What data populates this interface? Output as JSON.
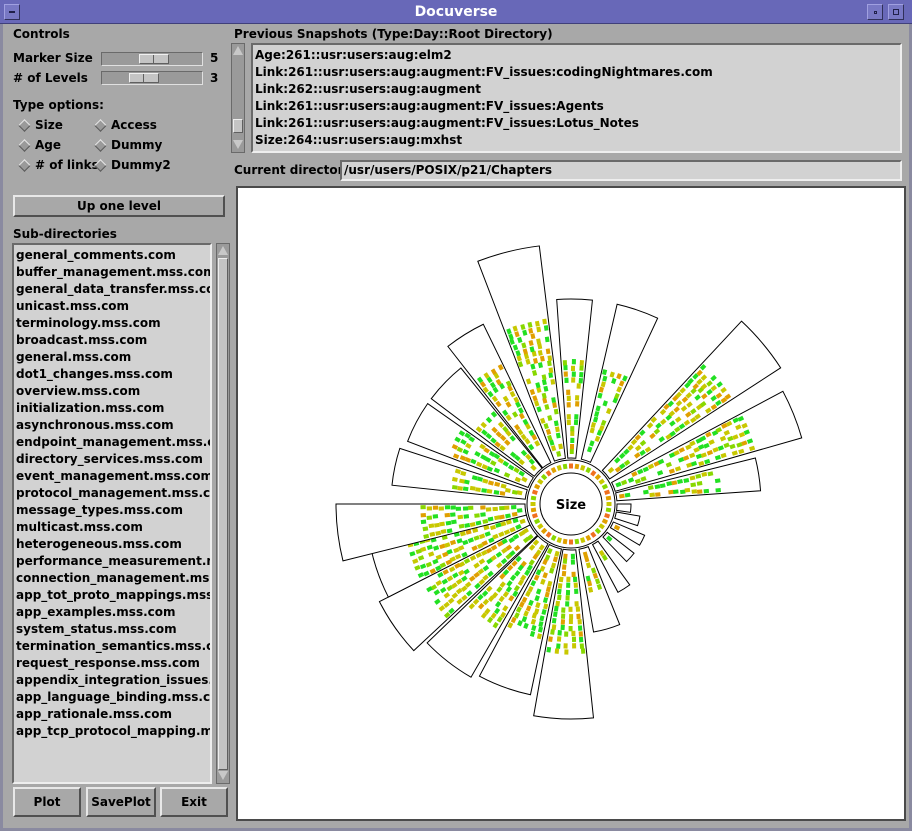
{
  "window": {
    "title": "Docuverse"
  },
  "controls": {
    "heading": "Controls",
    "marker_size_label": "Marker Size",
    "marker_size_value": "5",
    "marker_size_fraction": 0.55,
    "levels_label": "# of Levels",
    "levels_value": "3",
    "levels_fraction": 0.4,
    "type_options_label": "Type options:",
    "type_options": [
      "Size",
      "Access",
      "Age",
      "Dummy",
      "# of links",
      "Dummy2"
    ],
    "up_button": "Up one level"
  },
  "subdirs": {
    "heading": "Sub-directories",
    "items": [
      "general_comments.com",
      "buffer_management.mss.com",
      "general_data_transfer.mss.com",
      "unicast.mss.com",
      "terminology.mss.com",
      "broadcast.mss.com",
      "general.mss.com",
      "dot1_changes.mss.com",
      "overview.mss.com",
      "initialization.mss.com",
      "asynchronous.mss.com",
      "endpoint_management.mss.com",
      "directory_services.mss.com",
      "event_management.mss.com",
      "protocol_management.mss.com",
      "message_types.mss.com",
      "multicast.mss.com",
      "heterogeneous.mss.com",
      "performance_measurement.mss",
      "connection_management.mss.co",
      "app_tot_proto_mappings.mss.co",
      "app_examples.mss.com",
      "system_status.mss.com",
      "termination_semantics.mss.com",
      "request_response.mss.com",
      "appendix_integration_issues.ms:",
      "app_language_binding.mss.com",
      "app_rationale.mss.com",
      "app_tcp_protocol_mapping.mss."
    ]
  },
  "bottom_buttons": {
    "plot": "Plot",
    "saveplot": "SavePlot",
    "exit": "Exit"
  },
  "snapshots": {
    "heading": "Previous Snapshots (Type:Day::Root Directory)",
    "items": [
      "Age:261::usr:users:aug:elm2",
      "Link:261::usr:users:aug:augment:FV_issues:codingNightmares.com",
      "Link:262::usr:users:aug:augment",
      "Link:261::usr:users:aug:augment:FV_issues:Agents",
      "Link:261::usr:users:aug:augment:FV_issues:Lotus_Notes",
      "Size:264::usr:users:aug:mxhst"
    ]
  },
  "current_dir": {
    "label": "Current directory:",
    "value": "/usr/users/POSIX/p21/Chapters"
  },
  "plot": {
    "center_label": "Size",
    "colors": {
      "green": "#22e022",
      "lime": "#88d800",
      "olive": "#c8c800",
      "amber": "#e0a000",
      "orange": "#f07020"
    }
  }
}
